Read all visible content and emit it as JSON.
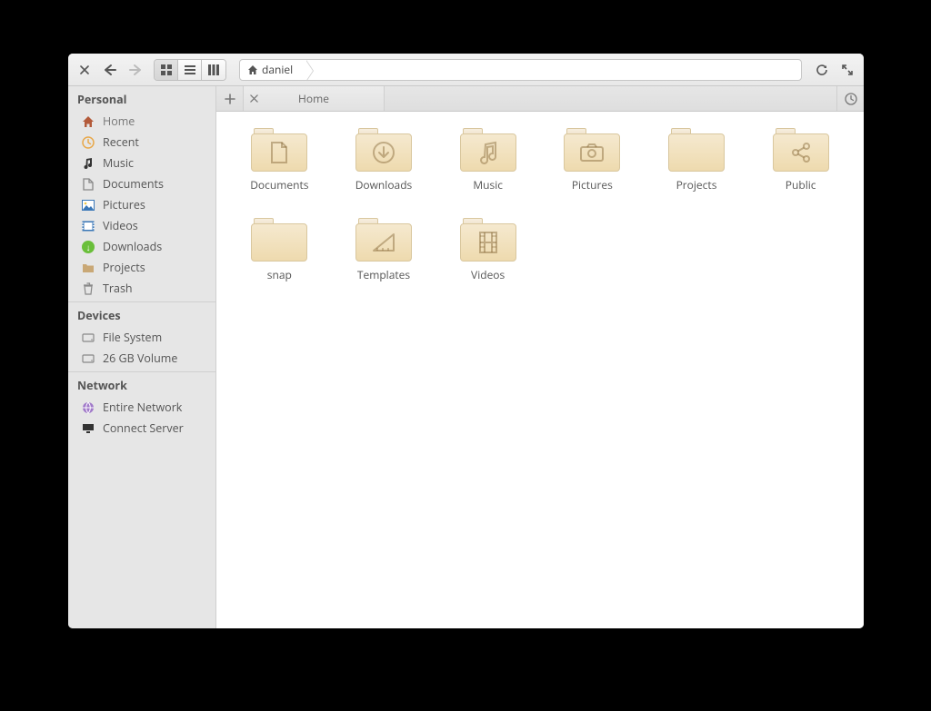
{
  "toolbar": {
    "path_segment": "daniel"
  },
  "tabs": {
    "active_label": "Home"
  },
  "sidebar": {
    "headings": {
      "personal": "Personal",
      "devices": "Devices",
      "network": "Network"
    },
    "personal": [
      {
        "label": "Home",
        "icon": "home"
      },
      {
        "label": "Recent",
        "icon": "recent"
      },
      {
        "label": "Music",
        "icon": "music"
      },
      {
        "label": "Documents",
        "icon": "docs"
      },
      {
        "label": "Pictures",
        "icon": "pics"
      },
      {
        "label": "Videos",
        "icon": "vids"
      },
      {
        "label": "Downloads",
        "icon": "down"
      },
      {
        "label": "Projects",
        "icon": "proj"
      },
      {
        "label": "Trash",
        "icon": "trash"
      }
    ],
    "devices": [
      {
        "label": "File System",
        "icon": "disk"
      },
      {
        "label": "26 GB Volume",
        "icon": "disk"
      }
    ],
    "network": [
      {
        "label": "Entire Network",
        "icon": "net"
      },
      {
        "label": "Connect Server",
        "icon": "srv"
      }
    ]
  },
  "folders": [
    {
      "label": "Documents",
      "glyph": "doc"
    },
    {
      "label": "Downloads",
      "glyph": "download"
    },
    {
      "label": "Music",
      "glyph": "music"
    },
    {
      "label": "Pictures",
      "glyph": "camera"
    },
    {
      "label": "Projects",
      "glyph": "plain"
    },
    {
      "label": "Public",
      "glyph": "share"
    },
    {
      "label": "snap",
      "glyph": "plain"
    },
    {
      "label": "Templates",
      "glyph": "ruler"
    },
    {
      "label": "Videos",
      "glyph": "film"
    }
  ]
}
